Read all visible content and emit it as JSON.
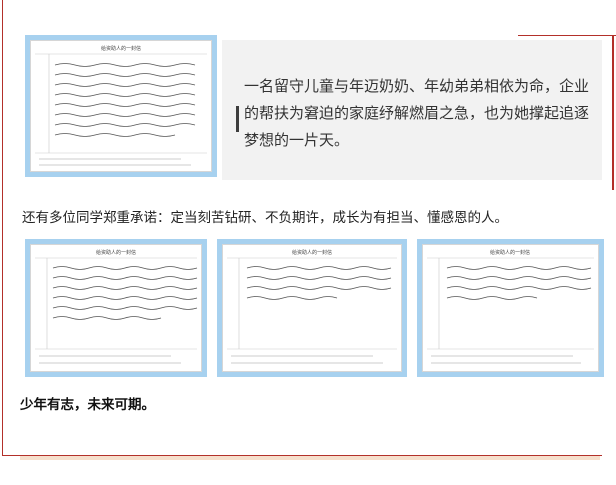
{
  "quote": {
    "text": "一名留守儿童与年迈奶奶、年幼弟弟相依为命，企业的帮扶为窘迫的家庭纾解燃眉之急，也为她撑起追逐梦想的一片天。"
  },
  "pledge": {
    "text": "还有多位同学郑重承诺：定当刻苦钻研、不负期许，成长为有担当、懂感恩的人。"
  },
  "motto": {
    "text": "少年有志，未来可期。"
  },
  "letters": [
    {
      "header": "给资助人的一封信"
    },
    {
      "header": "给资助人的一封信"
    },
    {
      "header": "给资助人的一封信"
    },
    {
      "header": "给资助人的一封信"
    }
  ],
  "colors": {
    "frame": "#b3302a",
    "letter_border": "#a7d1ef",
    "quote_bg": "#f2f2f2"
  }
}
